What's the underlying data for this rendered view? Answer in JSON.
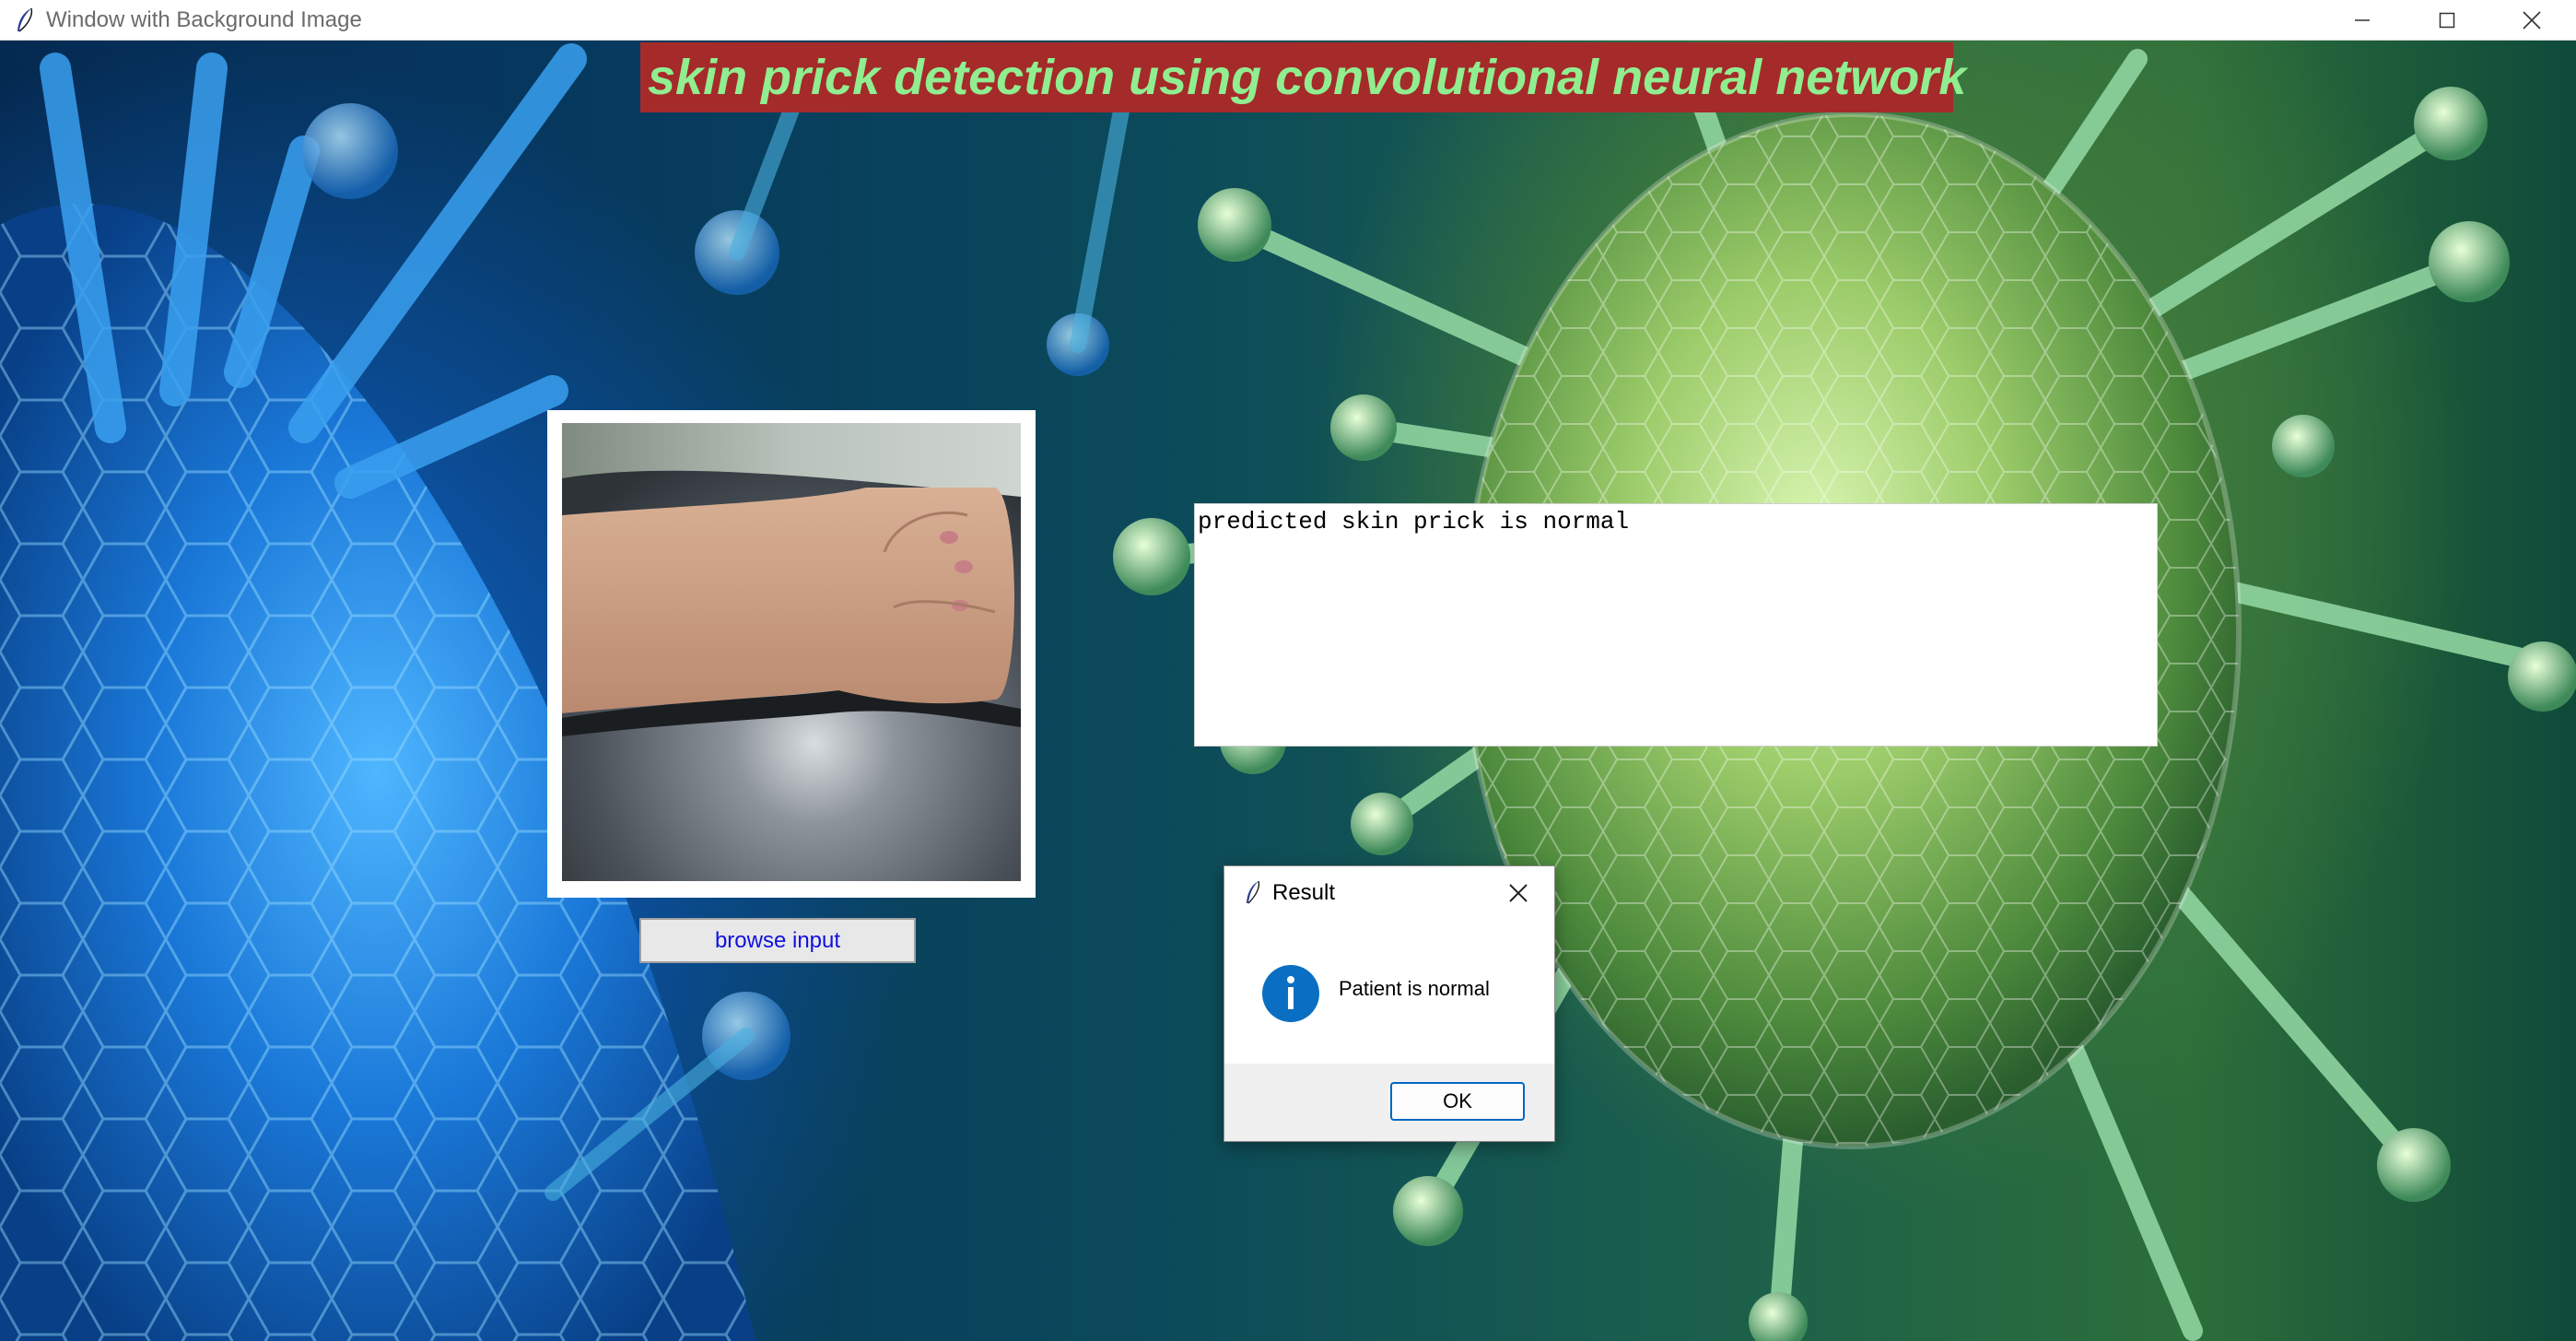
{
  "window": {
    "title": "Window with Background Image"
  },
  "app": {
    "heading": "skin prick detection using convolutional neural network",
    "browse_button_label": "browse input",
    "output_text": "predicted skin prick is normal"
  },
  "dialog": {
    "title": "Result",
    "message": "Patient is normal",
    "ok_label": "OK",
    "icon": "info-icon"
  },
  "icons": {
    "app_icon": "feather-icon",
    "minimize": "minimize-icon",
    "maximize": "maximize-icon",
    "close": "close-icon"
  },
  "colors": {
    "heading_bg": "#a52a2a",
    "heading_text": "#90ee90",
    "browse_text": "#1010e0",
    "dialog_accent": "#0067c0",
    "info_icon": "#0a6fc2"
  }
}
